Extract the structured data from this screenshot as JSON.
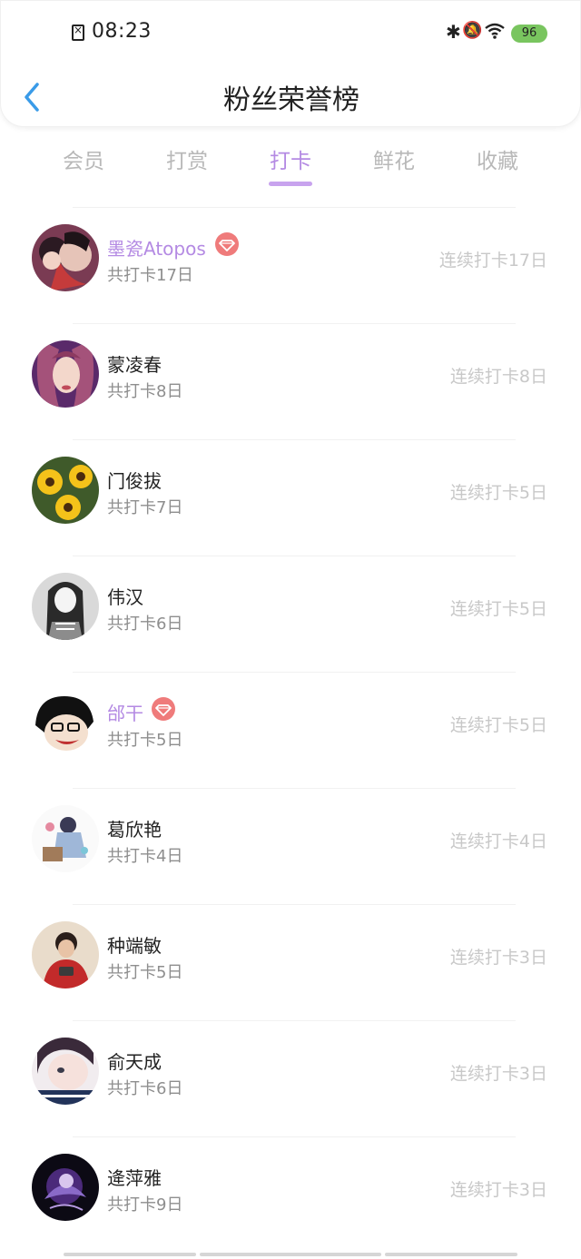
{
  "status_bar": {
    "time": "08:23",
    "battery": "96",
    "battery_color": "#79c55f"
  },
  "nav": {
    "title": "粉丝荣誉榜",
    "back_icon": "chevron-left-icon",
    "accent": "#3a9be8"
  },
  "tabs": [
    {
      "label": "会员",
      "active": false
    },
    {
      "label": "打赏",
      "active": false
    },
    {
      "label": "打卡",
      "active": true
    },
    {
      "label": "鲜花",
      "active": false
    },
    {
      "label": "收藏",
      "active": false
    }
  ],
  "colors": {
    "accent_purple": "#b48ae3",
    "gem_red": "#ef7b7b"
  },
  "fans": [
    {
      "name": "墨瓷Atopos",
      "vip": true,
      "total": "共打卡17日",
      "streak": "连续打卡17日",
      "avatar": "avatar-anime-couple"
    },
    {
      "name": "蒙凌春",
      "vip": false,
      "total": "共打卡8日",
      "streak": "连续打卡8日",
      "avatar": "avatar-girl-purple"
    },
    {
      "name": "门俊拔",
      "vip": false,
      "total": "共打卡7日",
      "streak": "连续打卡5日",
      "avatar": "avatar-yellow-flowers"
    },
    {
      "name": "伟汉",
      "vip": false,
      "total": "共打卡6日",
      "streak": "连续打卡5日",
      "avatar": "avatar-anime-gray"
    },
    {
      "name": "邰干",
      "vip": true,
      "total": "共打卡5日",
      "streak": "连续打卡5日",
      "avatar": "avatar-cartoon-face"
    },
    {
      "name": "葛欣艳",
      "vip": false,
      "total": "共打卡4日",
      "streak": "连续打卡4日",
      "avatar": "avatar-illustration"
    },
    {
      "name": "种端敏",
      "vip": false,
      "total": "共打卡5日",
      "streak": "连续打卡3日",
      "avatar": "avatar-man-red"
    },
    {
      "name": "俞天成",
      "vip": false,
      "total": "共打卡6日",
      "streak": "连续打卡3日",
      "avatar": "avatar-girl-closeup"
    },
    {
      "name": "逄萍雅",
      "vip": false,
      "total": "共打卡9日",
      "streak": "连续打卡3日",
      "avatar": "avatar-dark-purple"
    }
  ]
}
